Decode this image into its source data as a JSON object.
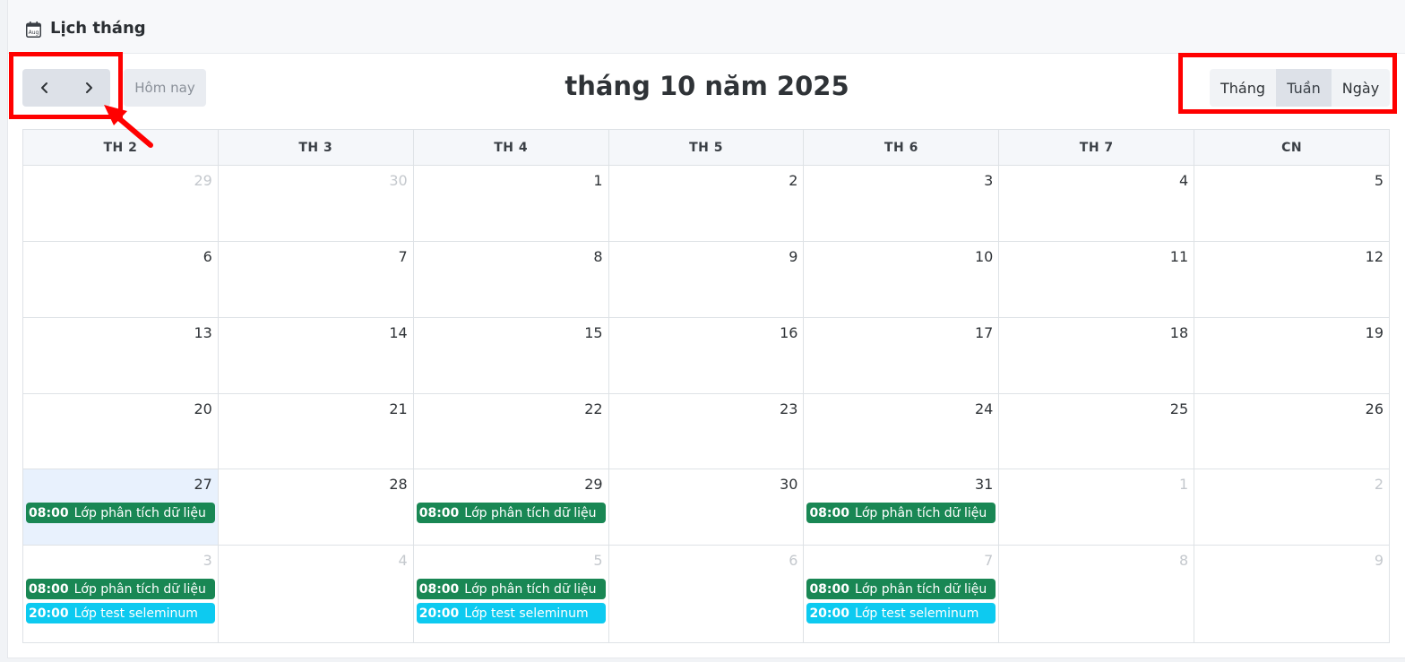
{
  "header": {
    "title": "Lịch tháng",
    "icon": "calendar-icon",
    "icon_text": "Aug"
  },
  "toolbar": {
    "prev_icon": "chevron-left-icon",
    "next_icon": "chevron-right-icon",
    "today_label": "Hôm nay",
    "title": "tháng 10 năm 2025",
    "views": [
      {
        "label": "Tháng",
        "active": false
      },
      {
        "label": "Tuần",
        "active": true
      },
      {
        "label": "Ngày",
        "active": false
      }
    ]
  },
  "annotations_color": "#ff0000",
  "colors": {
    "event_green": "#198754",
    "event_cyan": "#0dcaf0",
    "today_bg": "#e8f1fd"
  },
  "calendar": {
    "days_of_week": [
      "TH 2",
      "TH 3",
      "TH 4",
      "TH 5",
      "TH 6",
      "TH 7",
      "CN"
    ],
    "weeks": [
      {
        "days": [
          {
            "num": "29",
            "other": true
          },
          {
            "num": "30",
            "other": true
          },
          {
            "num": "1"
          },
          {
            "num": "2"
          },
          {
            "num": "3"
          },
          {
            "num": "4"
          },
          {
            "num": "5"
          }
        ]
      },
      {
        "days": [
          {
            "num": "6"
          },
          {
            "num": "7"
          },
          {
            "num": "8"
          },
          {
            "num": "9"
          },
          {
            "num": "10"
          },
          {
            "num": "11"
          },
          {
            "num": "12"
          }
        ]
      },
      {
        "days": [
          {
            "num": "13"
          },
          {
            "num": "14"
          },
          {
            "num": "15"
          },
          {
            "num": "16"
          },
          {
            "num": "17"
          },
          {
            "num": "18"
          },
          {
            "num": "19"
          }
        ]
      },
      {
        "days": [
          {
            "num": "20"
          },
          {
            "num": "21"
          },
          {
            "num": "22"
          },
          {
            "num": "23"
          },
          {
            "num": "24"
          },
          {
            "num": "25"
          },
          {
            "num": "26"
          }
        ]
      },
      {
        "days": [
          {
            "num": "27",
            "today": true,
            "events": [
              {
                "time": "08:00",
                "title": "Lớp phân tích dữ liệu",
                "color": "green"
              }
            ]
          },
          {
            "num": "28"
          },
          {
            "num": "29",
            "events": [
              {
                "time": "08:00",
                "title": "Lớp phân tích dữ liệu",
                "color": "green"
              }
            ]
          },
          {
            "num": "30"
          },
          {
            "num": "31",
            "events": [
              {
                "time": "08:00",
                "title": "Lớp phân tích dữ liệu",
                "color": "green"
              }
            ]
          },
          {
            "num": "1",
            "other": true
          },
          {
            "num": "2",
            "other": true
          }
        ]
      },
      {
        "days": [
          {
            "num": "3",
            "other": true,
            "events": [
              {
                "time": "08:00",
                "title": "Lớp phân tích dữ liệu",
                "color": "green"
              },
              {
                "time": "20:00",
                "title": "Lớp test seleminum",
                "color": "cyan"
              }
            ]
          },
          {
            "num": "4",
            "other": true
          },
          {
            "num": "5",
            "other": true,
            "events": [
              {
                "time": "08:00",
                "title": "Lớp phân tích dữ liệu",
                "color": "green"
              },
              {
                "time": "20:00",
                "title": "Lớp test seleminum",
                "color": "cyan"
              }
            ]
          },
          {
            "num": "6",
            "other": true
          },
          {
            "num": "7",
            "other": true,
            "events": [
              {
                "time": "08:00",
                "title": "Lớp phân tích dữ liệu",
                "color": "green"
              },
              {
                "time": "20:00",
                "title": "Lớp test seleminum",
                "color": "cyan"
              }
            ]
          },
          {
            "num": "8",
            "other": true
          },
          {
            "num": "9",
            "other": true
          }
        ]
      }
    ]
  }
}
